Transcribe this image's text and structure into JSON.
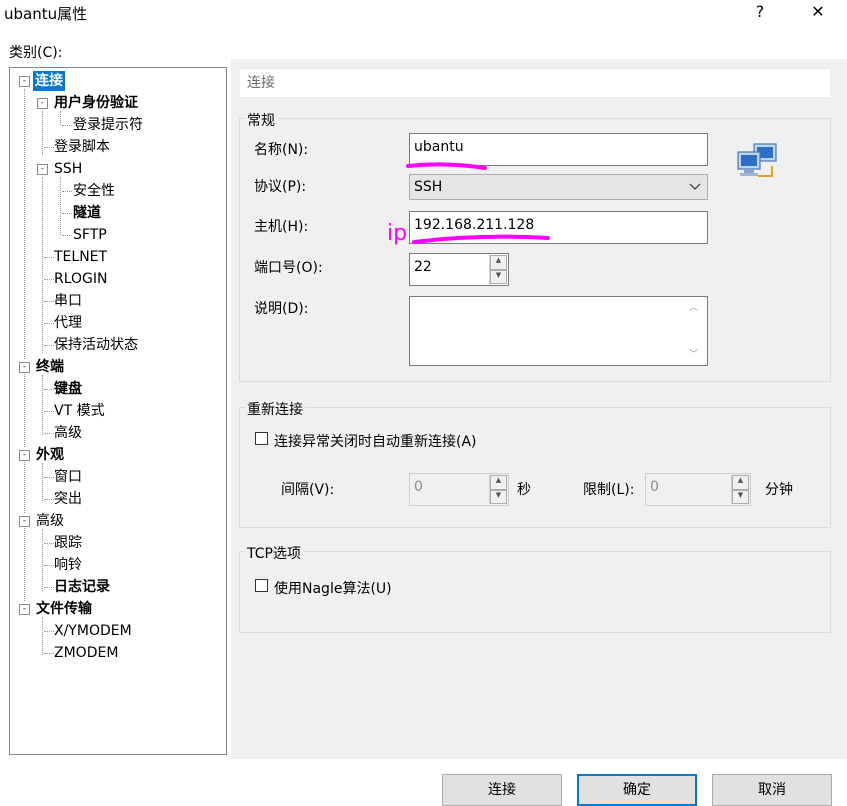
{
  "window": {
    "title": "ubantu属性",
    "help": "?",
    "close": "✕"
  },
  "category_label": "类别(C):",
  "tree": {
    "items": [
      {
        "label": "连接"
      },
      {
        "label": "用户身份验证"
      },
      {
        "label": "登录提示符"
      },
      {
        "label": "登录脚本"
      },
      {
        "label": "SSH"
      },
      {
        "label": "安全性"
      },
      {
        "label": "隧道"
      },
      {
        "label": "SFTP"
      },
      {
        "label": "TELNET"
      },
      {
        "label": "RLOGIN"
      },
      {
        "label": "串口"
      },
      {
        "label": "代理"
      },
      {
        "label": "保持活动状态"
      },
      {
        "label": "终端"
      },
      {
        "label": "键盘"
      },
      {
        "label": "VT 模式"
      },
      {
        "label": "高级"
      },
      {
        "label": "外观"
      },
      {
        "label": "窗口"
      },
      {
        "label": "突出"
      },
      {
        "label": "高级"
      },
      {
        "label": "跟踪"
      },
      {
        "label": "响铃"
      },
      {
        "label": "日志记录"
      },
      {
        "label": "文件传输"
      },
      {
        "label": "X/YMODEM"
      },
      {
        "label": "ZMODEM"
      }
    ],
    "expander_symbol": "-"
  },
  "header": "连接",
  "general": {
    "title": "常规",
    "name_label": "名称(N):",
    "name_value": "ubantu",
    "protocol_label": "协议(P):",
    "protocol_value": "SSH",
    "host_label": "主机(H):",
    "host_value": "192.168.211.128",
    "port_label": "端口号(O):",
    "port_value": "22",
    "desc_label": "说明(D):",
    "desc_value": "",
    "annotation": "ip",
    "annotation_color": "#ff00ff"
  },
  "reconnect": {
    "title": "重新连接",
    "auto_label": "连接异常关闭时自动重新连接(A)",
    "auto_checked": false,
    "interval_label": "间隔(V):",
    "interval_value": "0",
    "interval_unit": "秒",
    "limit_label": "限制(L):",
    "limit_value": "0",
    "limit_unit": "分钟"
  },
  "tcp": {
    "title": "TCP选项",
    "nagle_label": "使用Nagle算法(U)",
    "nagle_checked": false
  },
  "buttons": {
    "connect": "连接",
    "ok": "确定",
    "cancel": "取消"
  },
  "colors": {
    "selection": "#0078d7",
    "accent_border": "#0078d7"
  },
  "icons": {
    "session": "network-computers-icon",
    "dropdown": "chevron-down-icon",
    "spin_up": "spin-up-icon",
    "spin_down": "spin-down-icon"
  }
}
